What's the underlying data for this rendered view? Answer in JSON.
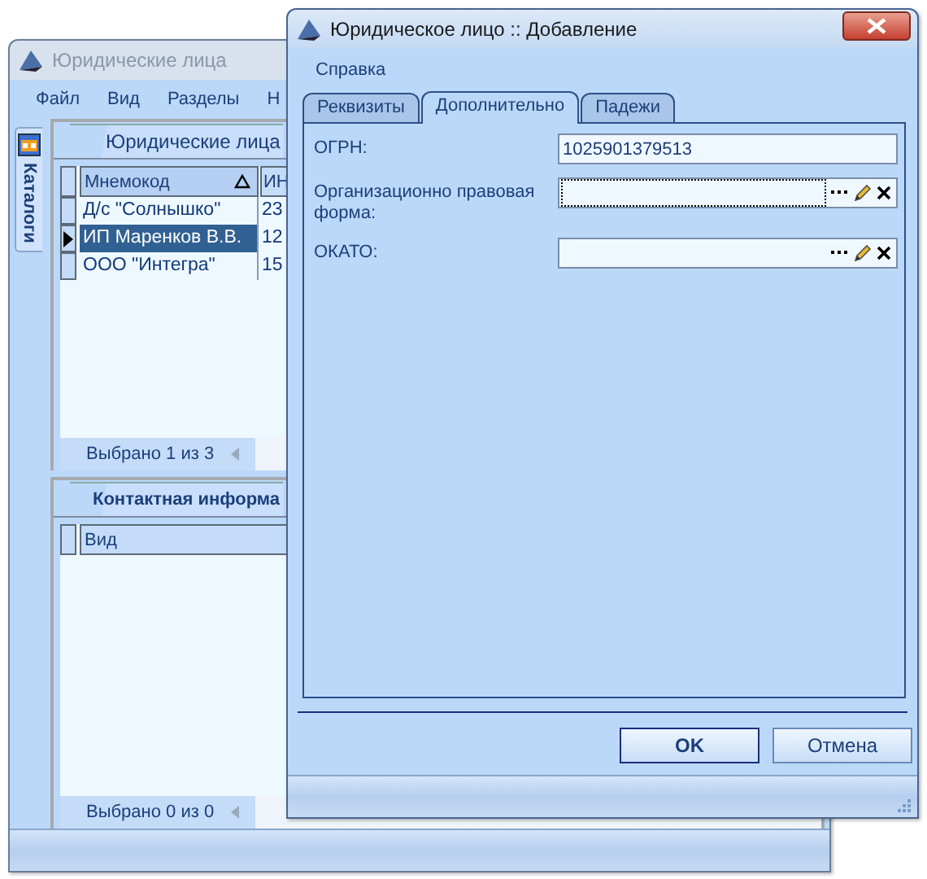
{
  "main_window": {
    "title": "Юридические лица",
    "menu": [
      "Файл",
      "Вид",
      "Разделы",
      "Н"
    ],
    "side_tabs": [
      "Каталоги"
    ],
    "sections": [
      {
        "title": "Юридические лица",
        "columns": [
          {
            "label": "Мнемокод",
            "sorted": true
          },
          {
            "label": "ИН",
            "sorted": false
          }
        ],
        "rows": [
          {
            "cells": [
              "Д/с \"Солнышко\"",
              "23"
            ],
            "selected": false
          },
          {
            "cells": [
              "ИП Маренков В.В.",
              "12"
            ],
            "selected": true
          },
          {
            "cells": [
              "ООО \"Интегра\"",
              "15"
            ],
            "selected": false
          }
        ],
        "footer": "Выбрано 1 из 3"
      },
      {
        "title": "Контактная информа",
        "columns": [
          {
            "label": "Вид",
            "sorted": false
          }
        ],
        "footer": "Выбрано 0 из 0"
      }
    ]
  },
  "dialog": {
    "title": "Юридическое лицо :: Добавление",
    "menu": [
      "Справка"
    ],
    "tabs": [
      {
        "label": "Реквизиты",
        "selected": false
      },
      {
        "label": "Дополнительно",
        "selected": true
      },
      {
        "label": "Падежи",
        "selected": false
      }
    ],
    "fields": [
      {
        "label": "ОГРН:",
        "value": "1025901379513",
        "kind": "text",
        "focused": false
      },
      {
        "label": "Организационно правовая форма:",
        "kind": "lookup",
        "focused": true
      },
      {
        "label": "ОКАТО:",
        "kind": "lookup",
        "focused": false
      }
    ],
    "buttons": [
      {
        "label": "OK",
        "default": true
      },
      {
        "label": "Отмена",
        "default": false
      }
    ]
  }
}
